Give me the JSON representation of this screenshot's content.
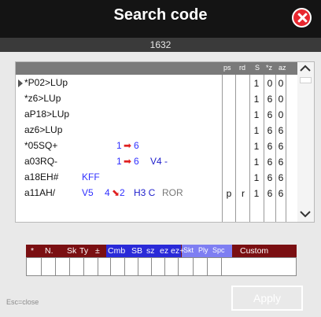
{
  "window": {
    "title": "Search code",
    "subtitle": "1632"
  },
  "close_icon": "close-icon",
  "results": {
    "columns": [
      "ps",
      "rd",
      "S",
      "*z",
      "az"
    ],
    "rows": [
      {
        "code": "*P02>LUp",
        "c1": "",
        "c2": "",
        "s": "1",
        "z": "0",
        "az": "0",
        "selected": true
      },
      {
        "code": "*z6>LUp",
        "c1": "",
        "c2": "",
        "s": "1",
        "z": "6",
        "az": "0"
      },
      {
        "code": "aP18>LUp",
        "c1": "",
        "c2": "",
        "s": "1",
        "z": "6",
        "az": "0"
      },
      {
        "code": "az6>LUp",
        "c1": "",
        "c2": "",
        "s": "1",
        "z": "6",
        "az": "6"
      },
      {
        "code": "*05SQ+",
        "c1": "",
        "c2": "",
        "s": "1",
        "z": "6",
        "az": "6",
        "extras": [
          {
            "text": "1",
            "color": "#3030ff"
          },
          {
            "text": "➡",
            "color": "#e02020"
          },
          {
            "text": "6",
            "color": "#3030ff"
          }
        ]
      },
      {
        "code": "a03RQ-",
        "c1": "",
        "c2": "",
        "s": "1",
        "z": "6",
        "az": "6",
        "extras": [
          {
            "text": "1",
            "color": "#3030ff"
          },
          {
            "text": "➡",
            "color": "#e02020"
          },
          {
            "text": "6",
            "color": "#3030ff"
          },
          {
            "text": "V4 -",
            "color": "#2020cc"
          }
        ]
      },
      {
        "code": "a18EH#",
        "c1": "",
        "c2": "",
        "s": "1",
        "z": "6",
        "az": "6",
        "extras": [
          {
            "text": "KFF",
            "color": "#3030ff"
          }
        ]
      },
      {
        "code": "a11AH/",
        "c1": "p",
        "c2": "r",
        "s": "1",
        "z": "6",
        "az": "6",
        "extras": [
          {
            "text": "V5",
            "color": "#3030ff"
          },
          {
            "text": "4",
            "color": "#3030ff"
          },
          {
            "text": "⬊",
            "color": "#e02020"
          },
          {
            "text": "2",
            "color": "#3030ff"
          },
          {
            "text": "H3 C",
            "color": "#2020cc"
          },
          {
            "text": "ROR",
            "color": "#777777"
          }
        ]
      }
    ]
  },
  "fields": {
    "labels": [
      "*",
      "N.",
      "Sk",
      "Ty",
      "±",
      "Cmb",
      "SB",
      "sz",
      "ez",
      "ez+",
      "Skt",
      "Ply",
      "Spc",
      "Custom"
    ],
    "colors": {
      "dark": "#7a0f12",
      "blue": "#2a2ad8",
      "light": "#7e7ef2"
    }
  },
  "footer": {
    "hint": "Esc=close",
    "apply_label": "Apply"
  }
}
